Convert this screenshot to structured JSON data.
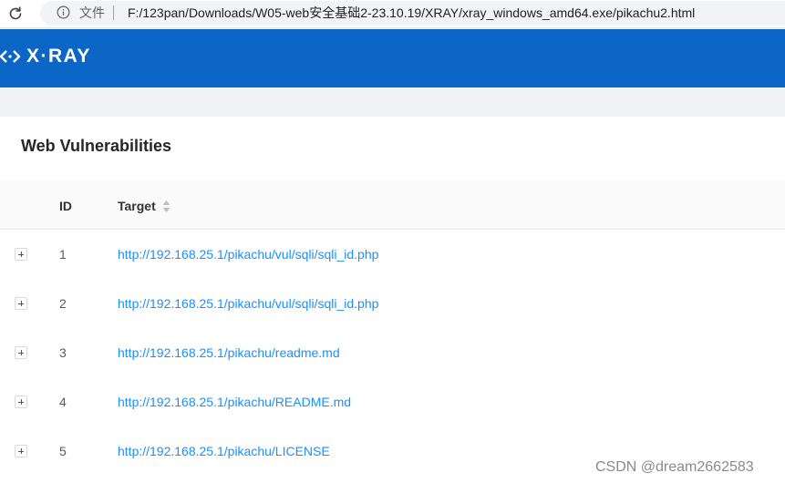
{
  "browser": {
    "file_label": "文件",
    "url": "F:/123pan/Downloads/W05-web安全基础2-23.10.19/XRAY/xray_windows_amd64.exe/pikachu2.html"
  },
  "header": {
    "logo_icon": "xray-logo-mark",
    "brand": "X·RAY",
    "color": "#0b66c5"
  },
  "card": {
    "title": "Web Vulnerabilities"
  },
  "table": {
    "columns": [
      "ID",
      "Target"
    ],
    "rows": [
      {
        "id": "1",
        "target": "http://192.168.25.1/pikachu/vul/sqli/sqli_id.php"
      },
      {
        "id": "2",
        "target": "http://192.168.25.1/pikachu/vul/sqli/sqli_id.php"
      },
      {
        "id": "3",
        "target": "http://192.168.25.1/pikachu/readme.md"
      },
      {
        "id": "4",
        "target": "http://192.168.25.1/pikachu/README.md"
      },
      {
        "id": "5",
        "target": "http://192.168.25.1/pikachu/LICENSE"
      }
    ]
  },
  "watermark": "CSDN @dream2662583",
  "colors": {
    "link": "#1890ff",
    "header_bg": "#0b66c5"
  }
}
